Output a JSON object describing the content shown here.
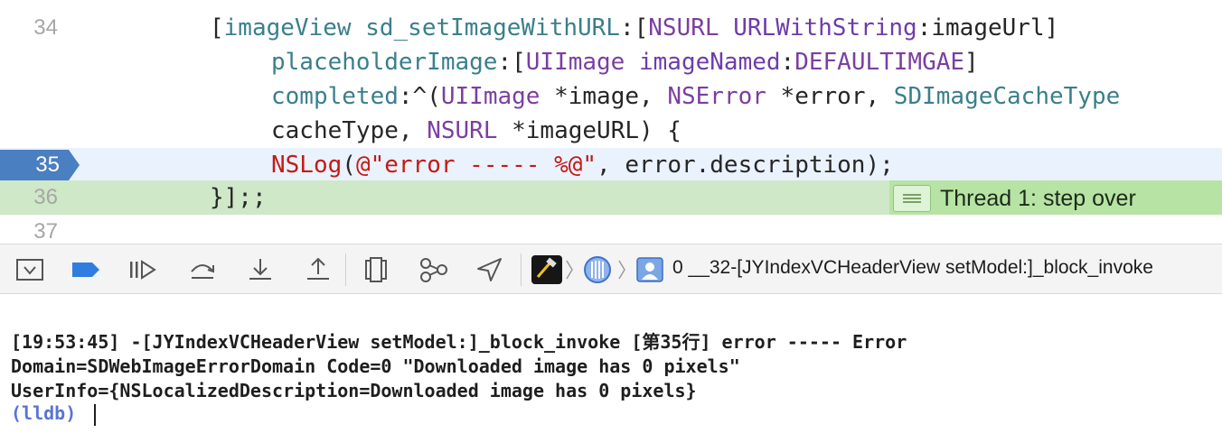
{
  "editor": {
    "lines": [
      {
        "num": "34",
        "parts": [
          "[",
          "imageView",
          " ",
          "sd_setImageWithURL",
          ":[",
          "NSURL",
          " ",
          "URLWithString",
          ":imageUrl]"
        ]
      },
      {
        "num": "",
        "parts": [
          "placeholderImage",
          ":[",
          "UIImage",
          " ",
          "imageNamed",
          ":",
          "DEFAULTIMGAE",
          "]"
        ]
      },
      {
        "num": "",
        "parts": [
          "completed",
          ":^(",
          "UIImage",
          " *image, ",
          "NSError",
          " *error, ",
          "SDImageCacheType"
        ]
      },
      {
        "num": "",
        "parts": [
          "cacheType, ",
          "NSURL",
          " *imageURL) {"
        ]
      },
      {
        "num": "35",
        "parts": [
          "NSLog",
          "(",
          "@\"error ----- %@\"",
          ", error.description);"
        ]
      },
      {
        "num": "36",
        "parts": [
          "}];;"
        ]
      },
      {
        "num": "37",
        "parts": []
      }
    ],
    "thread_badge": "Thread 1: step over"
  },
  "debugbar": {
    "buttons": [
      "hide-debug-area",
      "toggle-breakpoints",
      "continue",
      "step-over",
      "step-into",
      "step-out",
      "view-hierarchy",
      "memory-graph",
      "simulate-location"
    ],
    "breadcrumb": "0 __32-[JYIndexVCHeaderView setModel:]_block_invoke"
  },
  "console": {
    "log_lines": [
      "[19:53:45] -[JYIndexVCHeaderView setModel:]_block_invoke [第35行] error ----- Error",
      "Domain=SDWebImageErrorDomain Code=0 \"Downloaded image has 0 pixels\"",
      "UserInfo={NSLocalizedDescription=Downloaded image has 0 pixels}"
    ],
    "prompt": "(lldb) "
  },
  "colors": {
    "current_line": "#eaf2fd",
    "step_line": "#cfe8c8",
    "breakpoint": "#4a7fc1",
    "lldb_prompt": "#5a73d6"
  }
}
